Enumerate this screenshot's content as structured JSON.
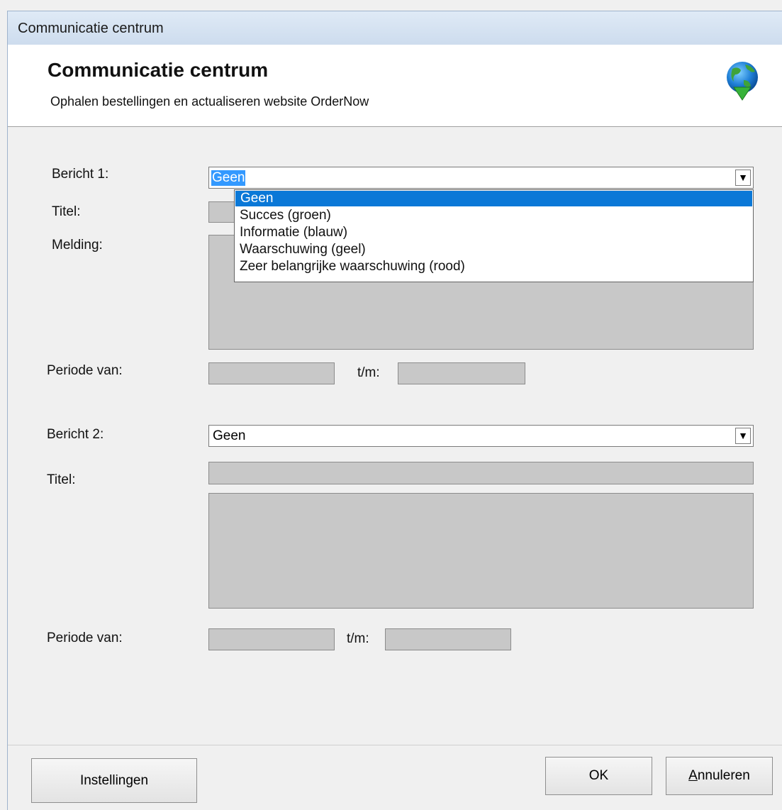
{
  "window": {
    "title": "Communicatie centrum"
  },
  "header": {
    "title": "Communicatie centrum",
    "subtitle": "Ophalen bestellingen en actualiseren website OrderNow"
  },
  "bericht1": {
    "label": "Bericht 1:",
    "value": "Geen",
    "titel_label": "Titel:",
    "melding_label": "Melding:",
    "periode_label": "Periode van:",
    "tm_label": "t/m:",
    "options": [
      "Geen",
      "Succes (groen)",
      "Informatie (blauw)",
      "Waarschuwing (geel)",
      "Zeer belangrijke waarschuwing (rood)"
    ]
  },
  "bericht2": {
    "label": "Bericht 2:",
    "value": "Geen",
    "titel_label": "Titel:",
    "periode_label": "Periode van:",
    "tm_label": "t/m:"
  },
  "footer": {
    "settings_label": "Instellingen",
    "ok_label": "OK",
    "cancel_label_prefix": "A",
    "cancel_label_rest": "nnuleren"
  },
  "colors": {
    "accent": "#0a78d7",
    "disabled_field": "#c8c8c8"
  },
  "icons": {
    "header": "globe-download-icon",
    "combo_arrow": "triangle-down-icon"
  }
}
